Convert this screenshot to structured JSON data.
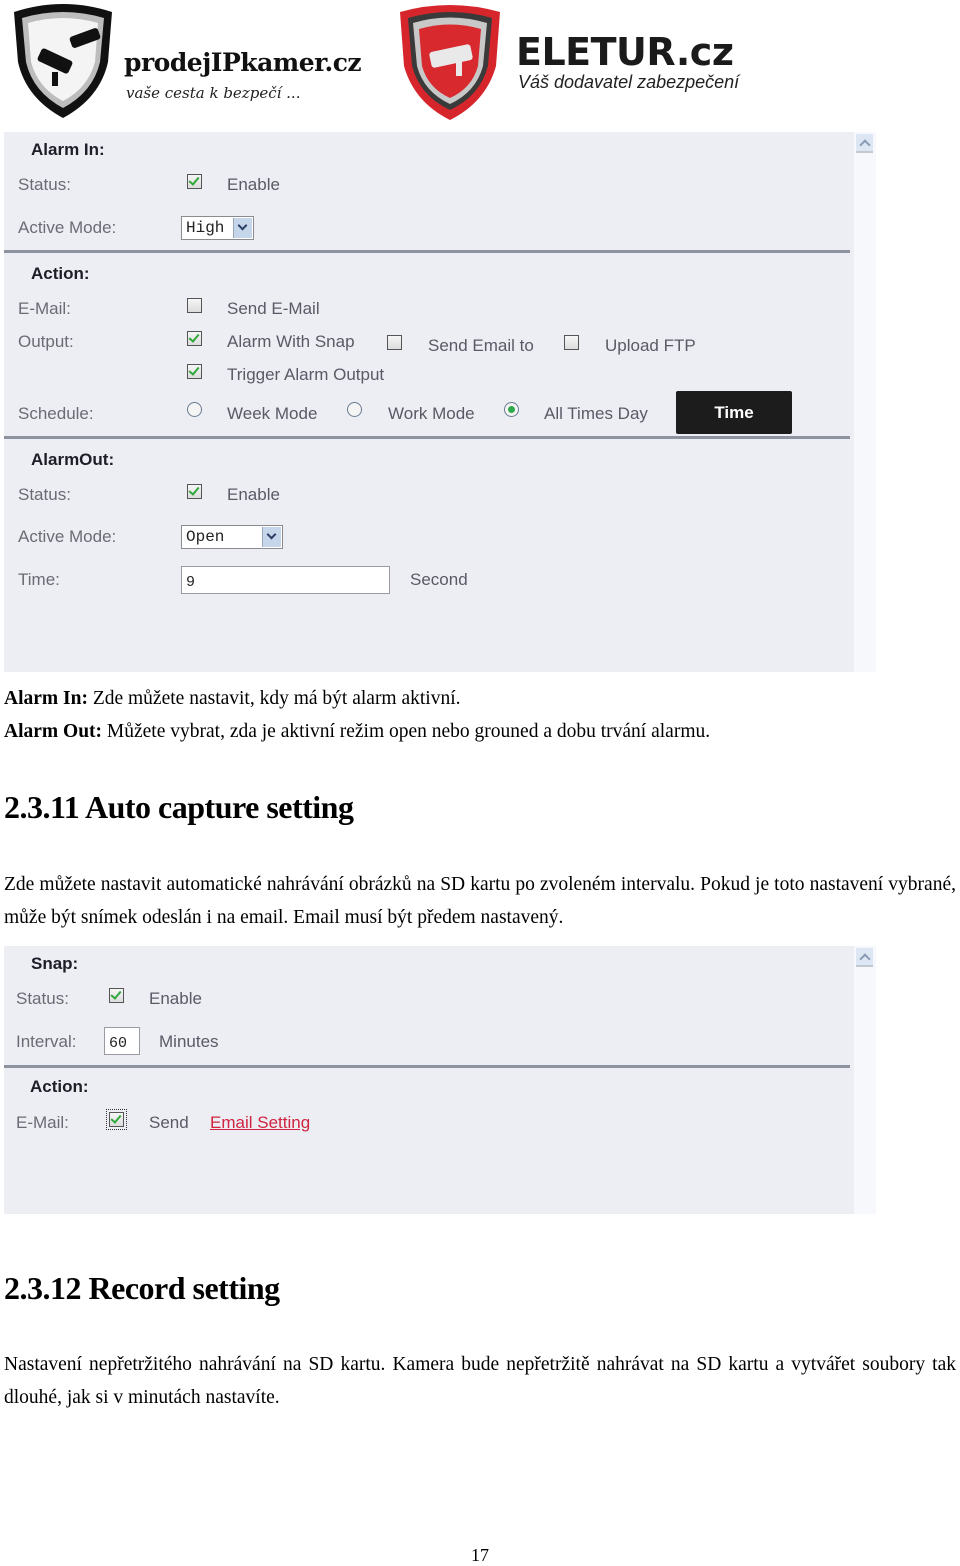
{
  "header": {
    "logo_left": {
      "name": "prodejIPkamer.cz",
      "tagline": "vaše cesta k bezpečí ..."
    },
    "logo_right": {
      "name": "ELETUR.cz",
      "tagline": "Váš dodavatel zabezpečení"
    }
  },
  "alarm_panel": {
    "alarm_in": {
      "title": "Alarm In:",
      "status_label": "Status:",
      "status_checked": true,
      "status_text": "Enable",
      "active_mode_label": "Active Mode:",
      "active_mode_value": "High"
    },
    "action": {
      "title": "Action:",
      "email_label": "E-Mail:",
      "send_email": {
        "checked": false,
        "text": "Send E-Mail"
      },
      "output_label": "Output:",
      "alarm_with_snap": {
        "checked": true,
        "text": "Alarm With Snap"
      },
      "send_email_to": {
        "checked": false,
        "text": "Send Email to"
      },
      "upload_ftp": {
        "checked": false,
        "text": "Upload FTP"
      },
      "trigger_alarm_output": {
        "checked": true,
        "text": "Trigger Alarm Output"
      },
      "schedule_label": "Schedule:",
      "schedule_options": [
        {
          "text": "Week Mode",
          "selected": false
        },
        {
          "text": "Work Mode",
          "selected": false
        },
        {
          "text": "All Times Day",
          "selected": true
        }
      ],
      "time_button": "Time"
    },
    "alarm_out": {
      "title": "AlarmOut:",
      "status_label": "Status:",
      "status_checked": true,
      "status_text": "Enable",
      "active_mode_label": "Active Mode:",
      "active_mode_value": "Open",
      "time_label": "Time:",
      "time_value": "9",
      "time_unit": "Second"
    }
  },
  "doc": {
    "alarm_in_desc": {
      "bold": "Alarm In:",
      "text": " Zde můžete nastavit, kdy má být alarm aktivní."
    },
    "alarm_out_desc": {
      "bold": "Alarm Out:",
      "text": " Můžete vybrat, zda je aktivní režim open nebo grouned a dobu trvání alarmu."
    },
    "section_auto_capture": "2.3.11 Auto capture setting",
    "auto_capture_text": "Zde můžete nastavit automatické nahrávání obrázků na SD kartu po zvoleném intervalu. Pokud je toto nastavení vybrané, může být snímek odeslán i na email. Email musí být předem nastavený.",
    "section_record": "2.3.12 Record setting",
    "record_text": "Nastavení nepřetržitého nahrávání na SD kartu. Kamera bude nepřetržitě nahrávat na SD kartu a vytvářet soubory tak dlouhé, jak si v minutách nastavíte.",
    "page_number": "17"
  },
  "snap_panel": {
    "snap": {
      "title": "Snap:",
      "status_label": "Status:",
      "status_checked": true,
      "status_text": "Enable",
      "interval_label": "Interval:",
      "interval_value": "60",
      "interval_unit": "Minutes"
    },
    "action": {
      "title": "Action:",
      "email_label": "E-Mail:",
      "send_checked": true,
      "send_text": "Send",
      "email_setting_link": "Email Setting"
    }
  },
  "colors": {
    "panel_bg": "#eceef4",
    "check_green": "#2fa83a",
    "link_red": "#d0233f",
    "button_dark": "#1c1c1c"
  }
}
